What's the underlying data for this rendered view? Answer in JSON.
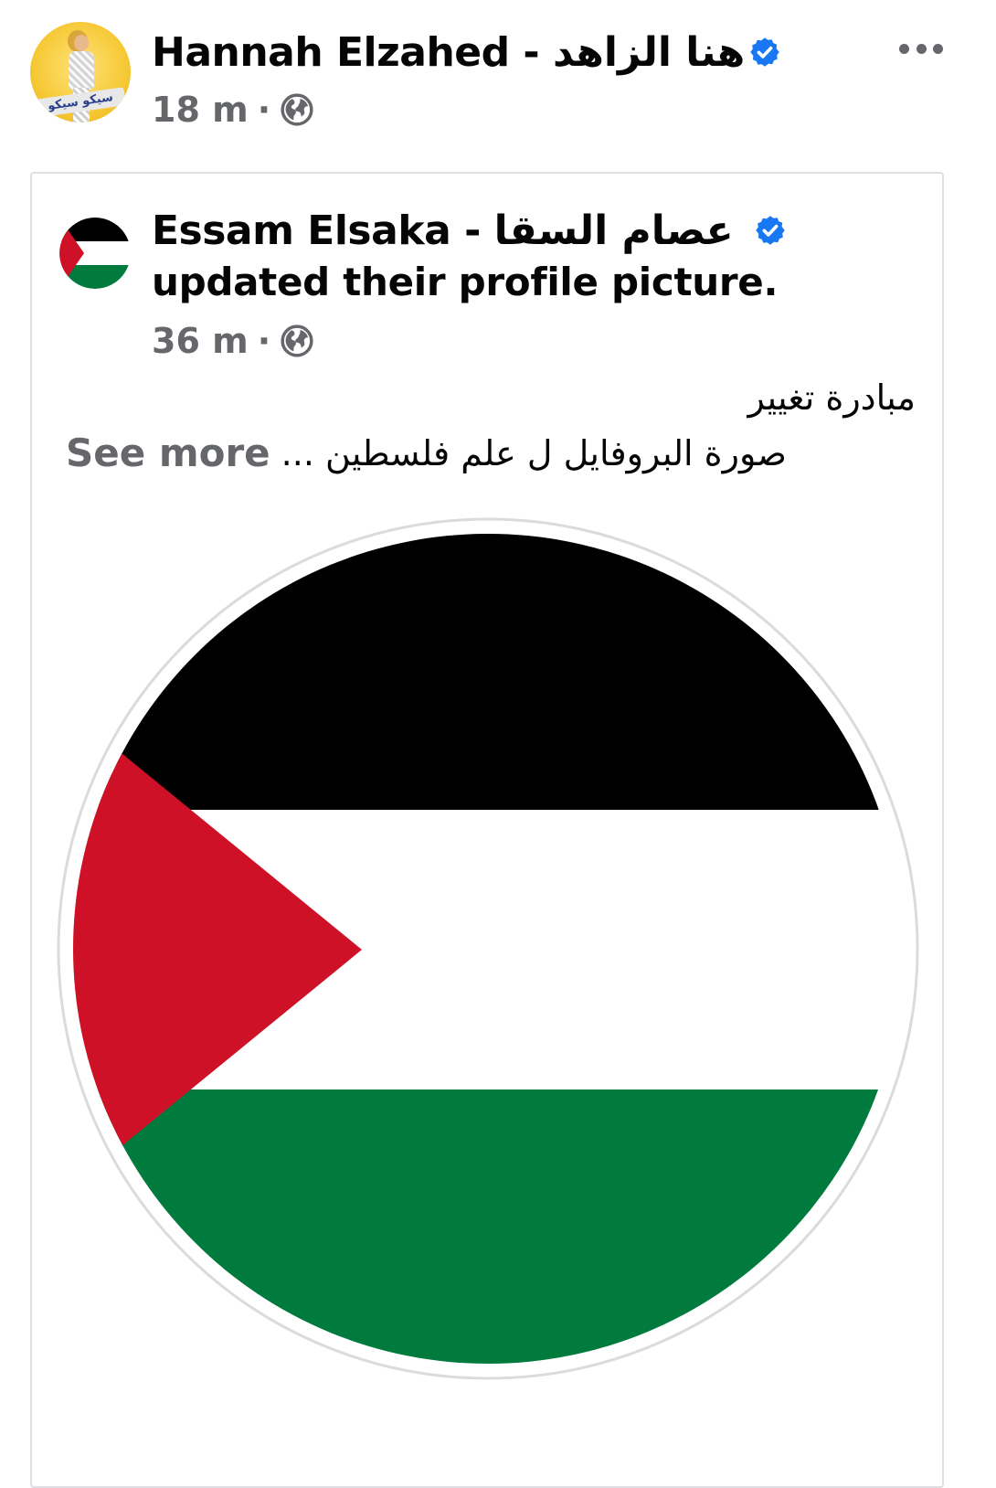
{
  "post": {
    "author_name": "Hannah Elzahed - هنا الزاهد",
    "author_avatar_banner": "سيكو سيكو",
    "time": "18 m",
    "separator": "·",
    "privacy_icon": "globe-icon",
    "verified_icon": "verified-badge-icon",
    "more_icon": "more-options-icon"
  },
  "shared": {
    "author_name": "Essam Elsaka - عصام السقا",
    "action": "updated their profile picture.",
    "time": "36 m",
    "separator": "·",
    "privacy_icon": "globe-icon",
    "caption_line1": "مبادرة تغيير",
    "caption_line2": "صورة البروفايل ل علم فلسطين ...",
    "see_more": "See more",
    "image": "palestine-flag-profile-picture"
  },
  "colors": {
    "verified_blue": "#1877f2",
    "meta_gray": "#65676b",
    "flag_black": "#000000",
    "flag_white": "#ffffff",
    "flag_green": "#007a3d",
    "flag_red": "#ce1126"
  }
}
